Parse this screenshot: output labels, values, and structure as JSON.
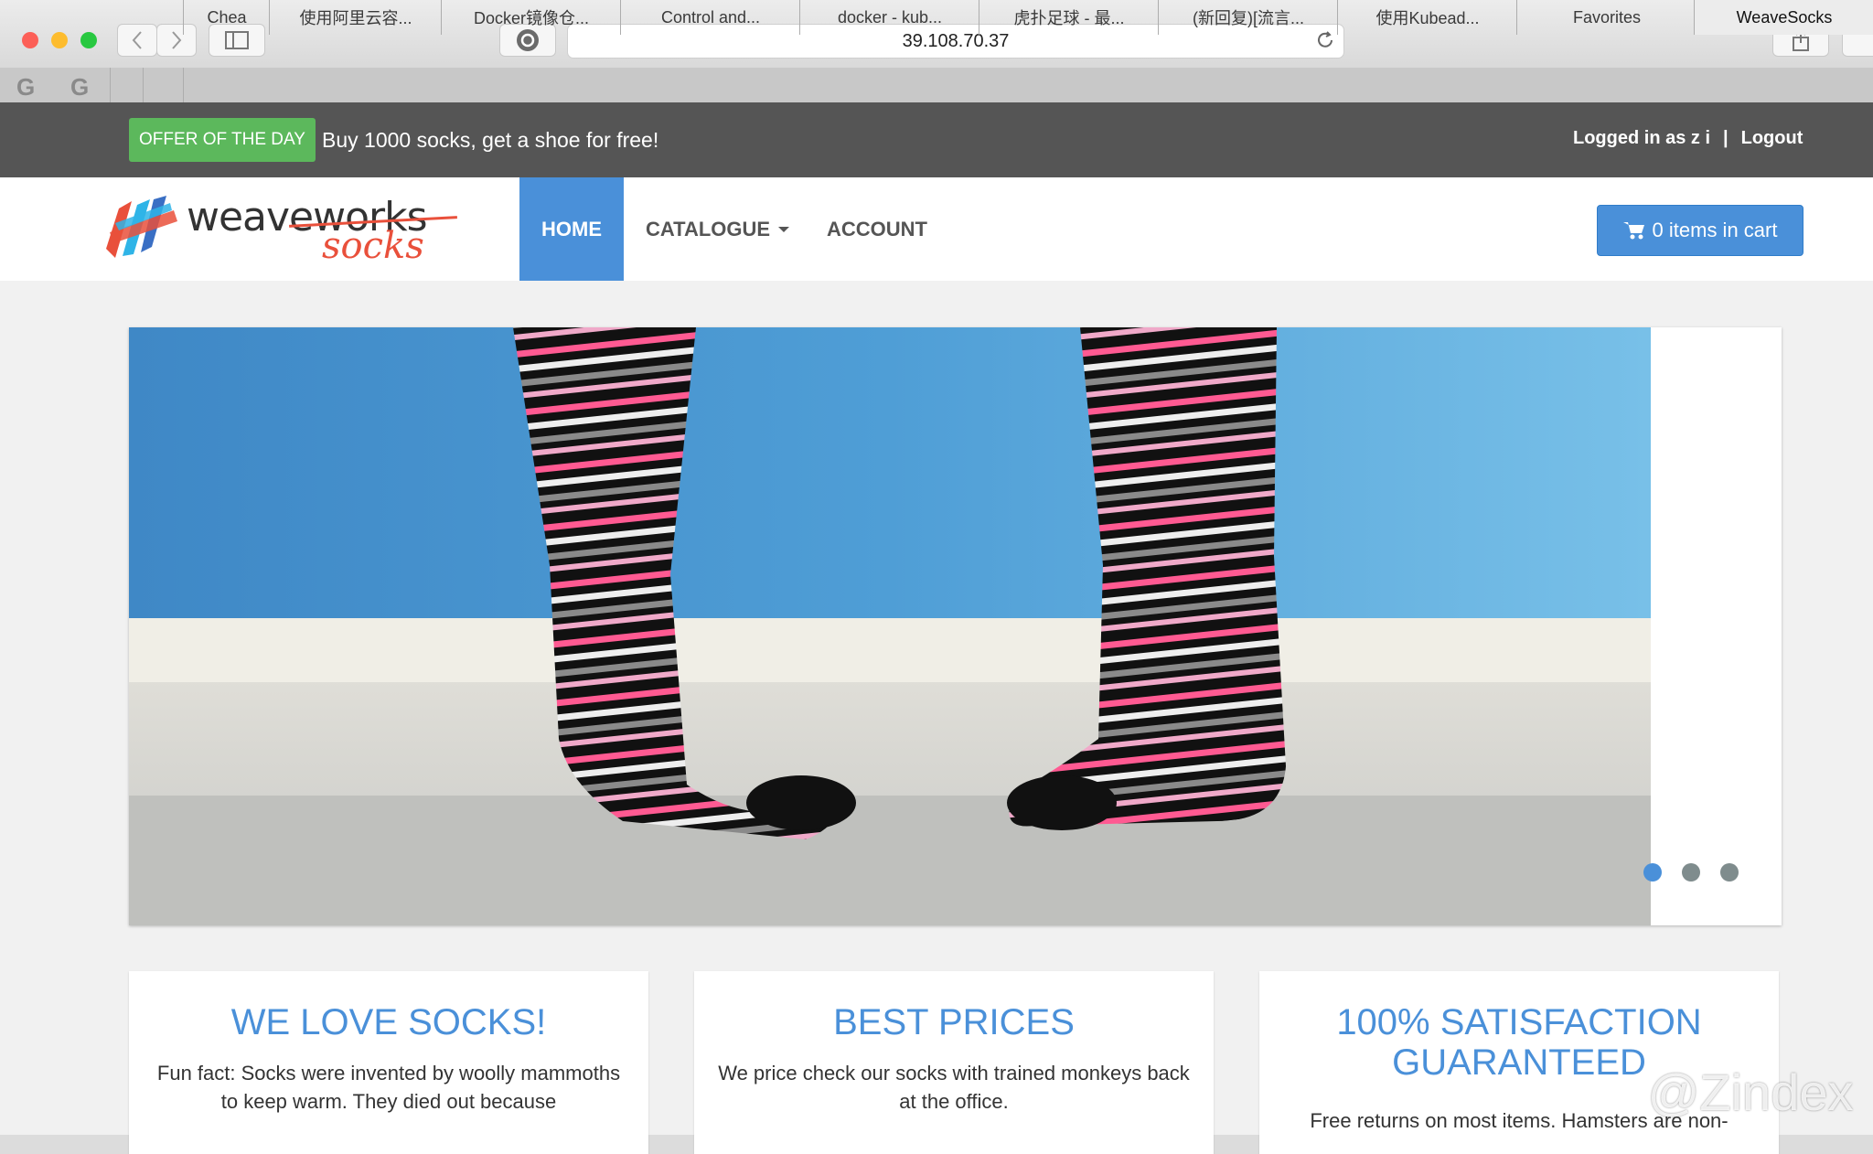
{
  "browser": {
    "url": "39.108.70.37",
    "tabs": [
      {
        "label": "Chea",
        "active": false
      },
      {
        "label": "使用阿里云容...",
        "active": false
      },
      {
        "label": "Docker镜像仓...",
        "active": false
      },
      {
        "label": "Control and...",
        "active": false
      },
      {
        "label": "docker - kub...",
        "active": false
      },
      {
        "label": "虎扑足球 - 最...",
        "active": false
      },
      {
        "label": "(新回复)[流言...",
        "active": false
      },
      {
        "label": "使用Kubead...",
        "active": false
      },
      {
        "label": "Favorites",
        "active": false
      },
      {
        "label": "WeaveSocks",
        "active": true
      }
    ],
    "pinned_tab_icon": "G"
  },
  "topbar": {
    "offer_label": "OFFER OF THE DAY",
    "offer_text": "Buy 1000 socks, get a shoe for free!",
    "logged_in": "Logged in as z i",
    "separator": "|",
    "logout": "Logout"
  },
  "logo": {
    "word1": "weaveworks",
    "word2": "socks"
  },
  "nav": {
    "home": "HOME",
    "catalogue": "CATALOGUE",
    "account": "ACCOUNT",
    "cart": "0 items in cart"
  },
  "slider": {
    "active_index": 0,
    "dot_count": 3
  },
  "features": [
    {
      "title": "WE LOVE SOCKS!",
      "text": "Fun fact: Socks were invented by woolly mammoths to keep warm. They died out because"
    },
    {
      "title": "BEST PRICES",
      "text": "We price check our socks with trained monkeys back at the office."
    },
    {
      "title": "100% SATISFACTION GUARANTEED",
      "text": "Free returns on most items. Hamsters are non-"
    }
  ],
  "watermark": "@Zindex",
  "colors": {
    "accent": "#4a90d9",
    "offer": "#5cb85c",
    "topbar": "#555555"
  }
}
